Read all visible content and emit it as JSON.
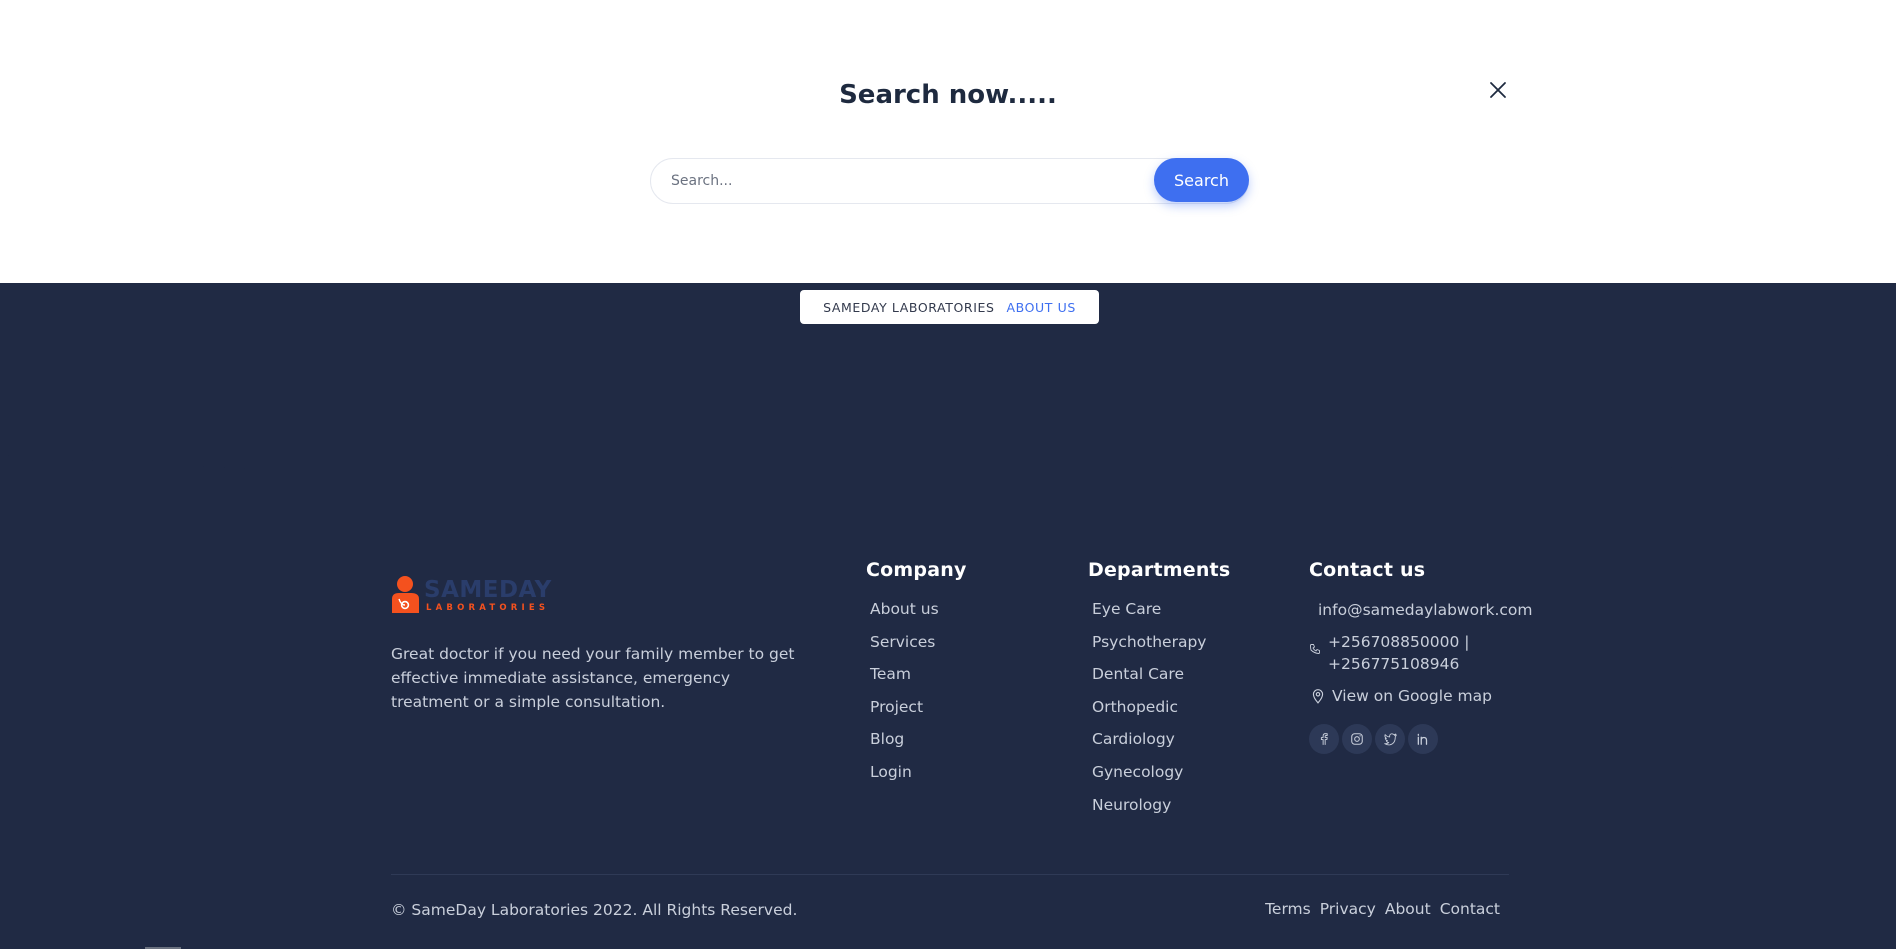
{
  "search": {
    "title": "Search now.....",
    "placeholder": "Search...",
    "button_label": "Search"
  },
  "breadcrumb": {
    "home": "SAMEDAY LABORATORIES",
    "separator": "",
    "current": "ABOUT US"
  },
  "footer": {
    "logo": {
      "name": "SAMEDAY",
      "tagline": "LABORATORIES"
    },
    "about_text": "Great doctor if you need your family member to get effective immediate assistance, emergency treatment or a simple consultation.",
    "company": {
      "heading": "Company",
      "links": [
        "About us",
        "Services",
        "Team",
        "Project",
        "Blog",
        "Login"
      ]
    },
    "departments": {
      "heading": "Departments",
      "links": [
        "Eye Care",
        "Psychotherapy",
        "Dental Care",
        "Orthopedic",
        "Cardiology",
        "Gynecology",
        "Neurology"
      ]
    },
    "contact": {
      "heading": "Contact us",
      "email": "info@samedaylabwork.com",
      "phone_line1": "+256708850000 |",
      "phone_line2": "+256775108946",
      "map_link": "View on Google map",
      "socials": [
        "facebook-icon",
        "instagram-icon",
        "twitter-icon",
        "linkedin-icon"
      ]
    },
    "copyright": "© SameDay Laboratories 2022. All Rights Reserved.",
    "legal_links": [
      "Terms",
      "Privacy",
      "About",
      "Contact"
    ]
  },
  "colors": {
    "primary": "#3e6ff0",
    "dark_bg": "#202a44",
    "logo_orange": "#f4511e",
    "logo_blue": "#2a3d6b"
  }
}
